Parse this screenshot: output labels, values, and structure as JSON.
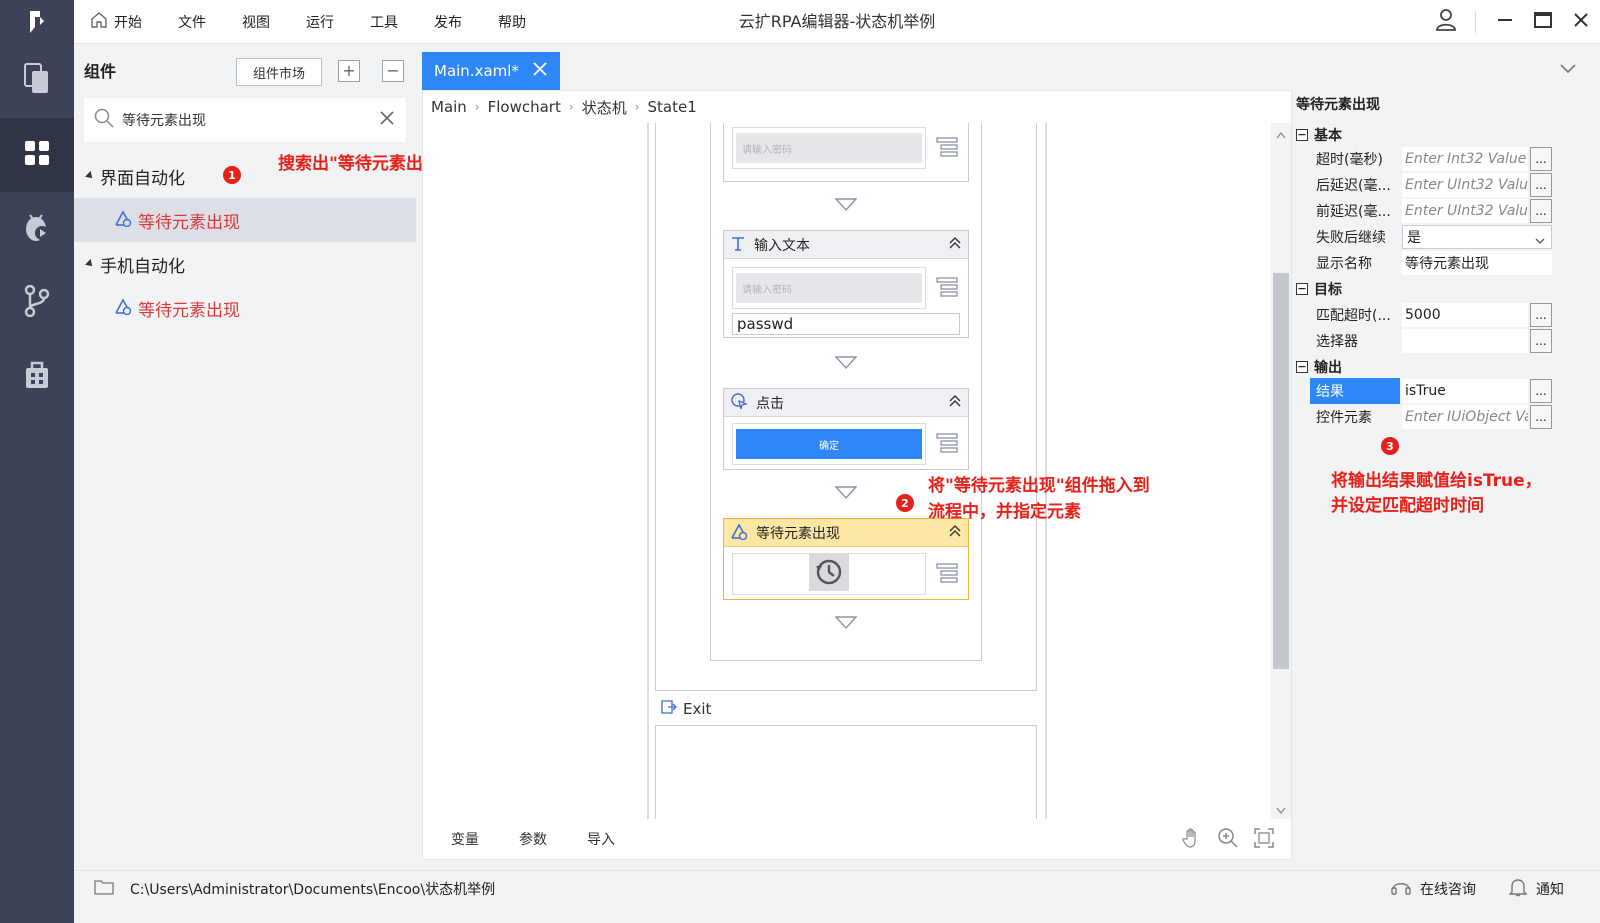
{
  "app": {
    "title": "云扩RPA编辑器-状态机举例"
  },
  "menu": {
    "home": "开始",
    "file": "文件",
    "view": "视图",
    "run": "运行",
    "tools": "工具",
    "publish": "发布",
    "help": "帮助"
  },
  "components": {
    "heading": "组件",
    "market_button": "组件市场",
    "expand_symbol": "+",
    "collapse_symbol": "−",
    "search_value": "等待元素出现",
    "categories": [
      {
        "label": "界面自动化",
        "child": "等待元素出现"
      },
      {
        "label": "手机自动化",
        "child": "等待元素出现"
      }
    ]
  },
  "annotations": {
    "a1": {
      "badge": "1",
      "text": "搜索出\"等待元素出现\"组件"
    },
    "a2": {
      "badge": "2",
      "line1": "将\"等待元素出现\"组件拖入到",
      "line2": "流程中，并指定元素"
    },
    "a3": {
      "badge": "3",
      "line1": "将输出结果赋值给isTrue，",
      "line2": "并设定匹配超时时间"
    }
  },
  "editor": {
    "tab_label": "Main.xaml*",
    "breadcrumb": [
      "Main",
      "Flowchart",
      "状态机",
      "State1"
    ],
    "activities": {
      "first_placeholder": "请输入密码",
      "input_text": {
        "title": "输入文本",
        "placeholder": "请输入密码",
        "value": "passwd"
      },
      "click": {
        "title": "点击",
        "button_text": "确定"
      },
      "wait": {
        "title": "等待元素出现"
      }
    },
    "exit_label": "Exit",
    "bottom_tabs": [
      "变量",
      "参数",
      "导入"
    ]
  },
  "properties": {
    "title": "等待元素出现",
    "groups": {
      "basic": {
        "label": "基本",
        "rows": [
          {
            "label": "超时(毫秒)",
            "value": "Enter Int32 Value"
          },
          {
            "label": "后延迟(毫...",
            "value": "Enter UInt32 Valu"
          },
          {
            "label": "前延迟(毫...",
            "value": "Enter UInt32 Valu"
          },
          {
            "label": "失败后继续",
            "value": "是"
          },
          {
            "label": "显示名称",
            "value": "等待元素出现"
          }
        ]
      },
      "target": {
        "label": "目标",
        "rows": [
          {
            "label": "匹配超时(...",
            "value": "5000"
          },
          {
            "label": "选择器",
            "value": ""
          }
        ]
      },
      "output": {
        "label": "输出",
        "rows": [
          {
            "label": "结果",
            "value": "isTrue"
          },
          {
            "label": "控件元素",
            "value": "Enter IUiObject Va"
          }
        ]
      }
    },
    "dots": "...",
    "group_toggle": "−"
  },
  "status": {
    "path": "C:\\Users\\Administrator\\Documents\\Encoo\\状态机举例",
    "consult": "在线咨询",
    "notify": "通知"
  },
  "colors": {
    "accent": "#2f86f6",
    "rail": "#3c4257",
    "annotation": "#e7211a",
    "active_activity": "#fde7a5"
  }
}
